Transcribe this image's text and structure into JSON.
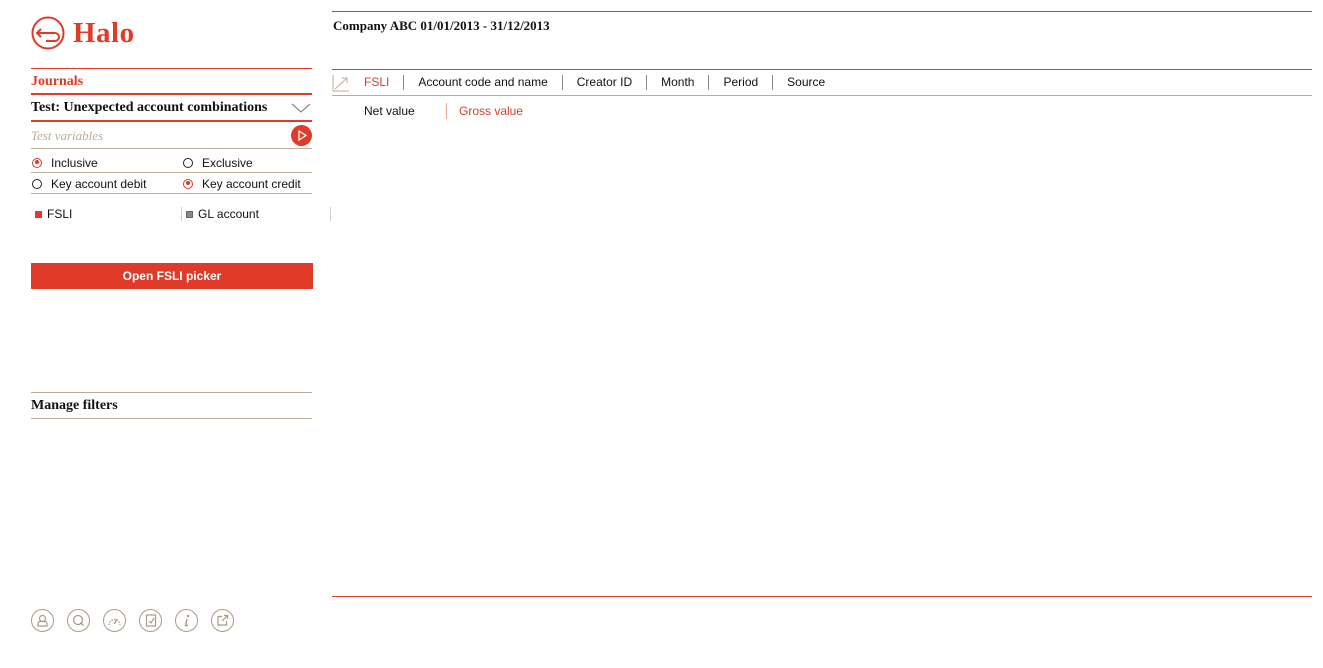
{
  "app": {
    "name": "Halo"
  },
  "sidebar": {
    "section_title": "Journals",
    "test_title": "Test: Unexpected account combinations",
    "variables_placeholder": "Test variables",
    "options": {
      "inclusive": "Inclusive",
      "exclusive": "Exclusive",
      "key_account_debit": "Key account debit",
      "key_account_credit": "Key account credit",
      "selected_mode": "Inclusive",
      "selected_key": "Key account credit"
    },
    "types": {
      "fsli": "FSLI",
      "gl_account": "GL account"
    },
    "picker_button": "Open FSLI picker",
    "manage_filters": "Manage filters",
    "footer_icons": [
      "user-icon",
      "search-icon",
      "dashboard-icon",
      "notes-icon",
      "info-icon",
      "external-link-icon"
    ]
  },
  "main": {
    "title": "Company ABC 01/01/2013 - 31/12/2013",
    "tabs": [
      "FSLI",
      "Account code and name",
      "Creator ID",
      "Month",
      "Period",
      "Source"
    ],
    "active_tab": "FSLI",
    "subtabs": [
      "Net value",
      "Gross value"
    ],
    "active_subtab": "Gross value"
  },
  "colors": {
    "accent": "#e03a28",
    "muted": "#b9ad9a",
    "icon": "#a89b84"
  }
}
